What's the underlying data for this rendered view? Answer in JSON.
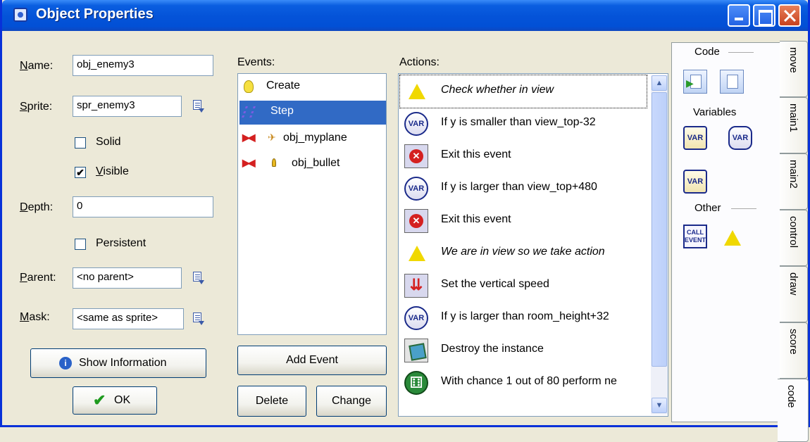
{
  "window": {
    "title": "Object Properties"
  },
  "props": {
    "name_label": "Name:",
    "name_value": "obj_enemy3",
    "sprite_label": "Sprite:",
    "sprite_value": "spr_enemy3",
    "solid_label": "Solid",
    "solid_checked": false,
    "visible_label": "Visible",
    "visible_checked": true,
    "depth_label": "Depth:",
    "depth_value": "0",
    "persistent_label": "Persistent",
    "persistent_checked": false,
    "parent_label": "Parent:",
    "parent_value": "<no parent>",
    "mask_label": "Mask:",
    "mask_value": "<same as sprite>",
    "show_info_label": "Show Information",
    "ok_label": "OK"
  },
  "events": {
    "header": "Events:",
    "items": [
      {
        "label": "Create",
        "icon": "lightbulb-icon",
        "selected": false
      },
      {
        "label": "Step",
        "icon": "step-icon",
        "selected": true
      },
      {
        "label": "obj_myplane",
        "icon": "collision-icon",
        "selected": false
      },
      {
        "label": "obj_bullet",
        "icon": "collision-icon",
        "selected": false
      }
    ],
    "add_label": "Add Event",
    "delete_label": "Delete",
    "change_label": "Change"
  },
  "actions": {
    "header": "Actions:",
    "items": [
      {
        "label": "Check whether in view",
        "icon": "warning-icon",
        "italic": true
      },
      {
        "label": "If y is smaller than view_top-32",
        "icon": "var-icon"
      },
      {
        "label": "Exit this event",
        "icon": "exit-icon"
      },
      {
        "label": "If y is larger than view_top+480",
        "icon": "var-icon"
      },
      {
        "label": "Exit this event",
        "icon": "exit-icon"
      },
      {
        "label": "We are in view so we take action",
        "icon": "warning-icon",
        "italic": true
      },
      {
        "label": "Set the vertical speed",
        "icon": "vspeed-icon"
      },
      {
        "label": "If y is larger than room_height+32",
        "icon": "var-icon"
      },
      {
        "label": "Destroy the instance",
        "icon": "destroy-icon"
      },
      {
        "label": "With chance 1 out of 80 perform ne",
        "icon": "dice-icon"
      }
    ]
  },
  "palette": {
    "code_header": "Code",
    "variables_header": "Variables",
    "other_header": "Other",
    "var_text": "VAR",
    "call_text": "CALL EVENT"
  },
  "tabs": [
    "move",
    "main1",
    "main2",
    "control",
    "draw",
    "score",
    "code"
  ],
  "active_tab": "code",
  "colors": {
    "title_blue": "#0453d8",
    "selection": "#316ac5",
    "face": "#ece9d8"
  }
}
